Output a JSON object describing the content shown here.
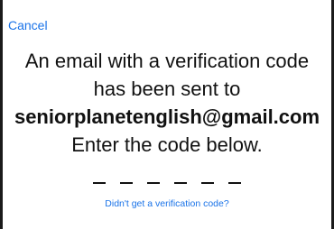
{
  "header": {
    "cancel_label": "Cancel"
  },
  "message": {
    "line1": "An email with a verification code",
    "line2": "has been sent to",
    "email": "seniorplanetenglish@gmail.com",
    "line4": "Enter the code below."
  },
  "code_input": {
    "slot_count": 6,
    "placeholder_char": "–"
  },
  "footer": {
    "resend_label": "Didn't get a verification code?"
  },
  "colors": {
    "link": "#1a73e8",
    "text": "#111111",
    "background": "#ffffff",
    "frame": "#1a1a1a"
  }
}
